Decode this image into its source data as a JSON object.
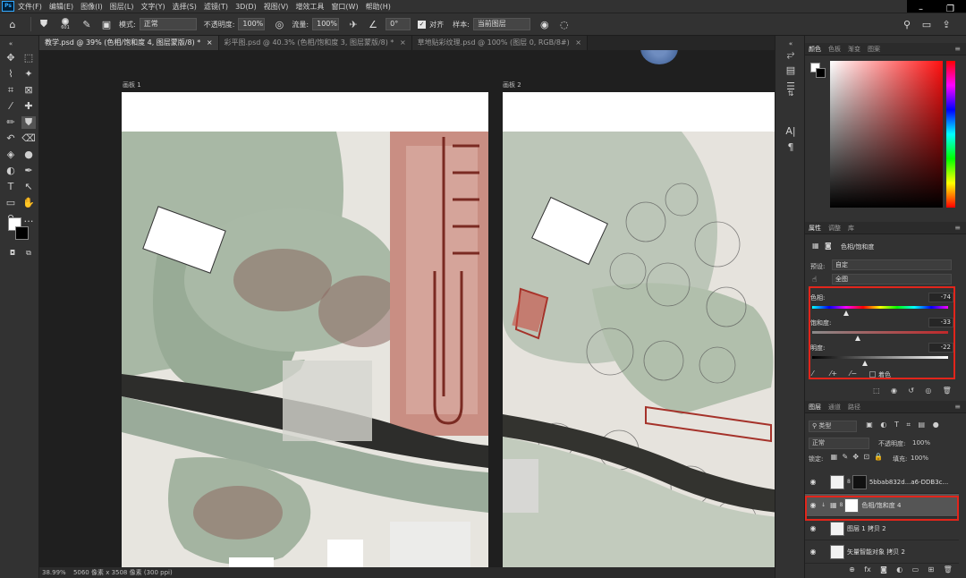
{
  "app": {
    "logo": "Ps"
  },
  "menubar": {
    "items": [
      "文件(F)",
      "编辑(E)",
      "图像(I)",
      "图层(L)",
      "文字(Y)",
      "选择(S)",
      "滤镜(T)",
      "3D(D)",
      "视图(V)",
      "增效工具",
      "窗口(W)",
      "帮助(H)"
    ]
  },
  "window_controls": {
    "minimize": "–",
    "restore": "❐"
  },
  "options": {
    "brush_size": "601",
    "mode_label": "模式:",
    "mode_value": "正常",
    "opacity_label": "不透明度:",
    "opacity_value": "100%",
    "flow_label": "流量:",
    "flow_value": "100%",
    "angle_value": "0°",
    "aligned_label": "对齐",
    "sample_label": "样本:",
    "sample_value": "当前图层"
  },
  "tabs": [
    {
      "label": "教学.psd @ 39% (色相/饱和度 4, 图层蒙版/8) *",
      "active": true
    },
    {
      "label": "彩平图.psd @ 40.3% (色相/饱和度 3, 图层蒙版/8) *",
      "active": false
    },
    {
      "label": "草地贴彩纹理.psd @ 100% (图层 0, RGB/8#)",
      "active": false
    }
  ],
  "canvas": {
    "artboard1_label": "画板 1",
    "artboard2_label": "画板 2"
  },
  "status": {
    "zoom": "38.99%",
    "doc_info": "5060 像素 x 3508 像素 (300 ppi)"
  },
  "color_panel": {
    "tabs": [
      "颜色",
      "色板",
      "渐变",
      "图案"
    ]
  },
  "properties_panel": {
    "tabs": [
      "属性",
      "调整",
      "库"
    ],
    "title": "色相/饱和度",
    "preset_label": "预设:",
    "preset_value": "自定",
    "channel_value": "全图",
    "hue_label": "色相:",
    "hue_value": "-74",
    "hue_fraction": 0.253,
    "sat_label": "饱和度:",
    "sat_value": "-33",
    "sat_fraction": 0.335,
    "light_label": "明度:",
    "light_value": "-22",
    "light_fraction": 0.39,
    "colorize_label": "着色"
  },
  "layers_panel": {
    "tabs": [
      "图层",
      "通道",
      "路径"
    ],
    "filter_value": "类型",
    "blend_value": "正常",
    "opacity_label": "不透明度:",
    "opacity_value": "100%",
    "lock_label": "锁定:",
    "fill_label": "填充:",
    "fill_value": "100%",
    "layers": [
      {
        "name": "5bbab832d...a6-DDB3c..."
      },
      {
        "name": "色相/饱和度 4"
      },
      {
        "name": "图层 1 拷贝 2"
      },
      {
        "name": "矢量智能对象 拷贝 2"
      }
    ]
  },
  "colors": {
    "highlight": "#e2251b",
    "panel_bg": "#323232",
    "menu_bg": "#323232"
  }
}
